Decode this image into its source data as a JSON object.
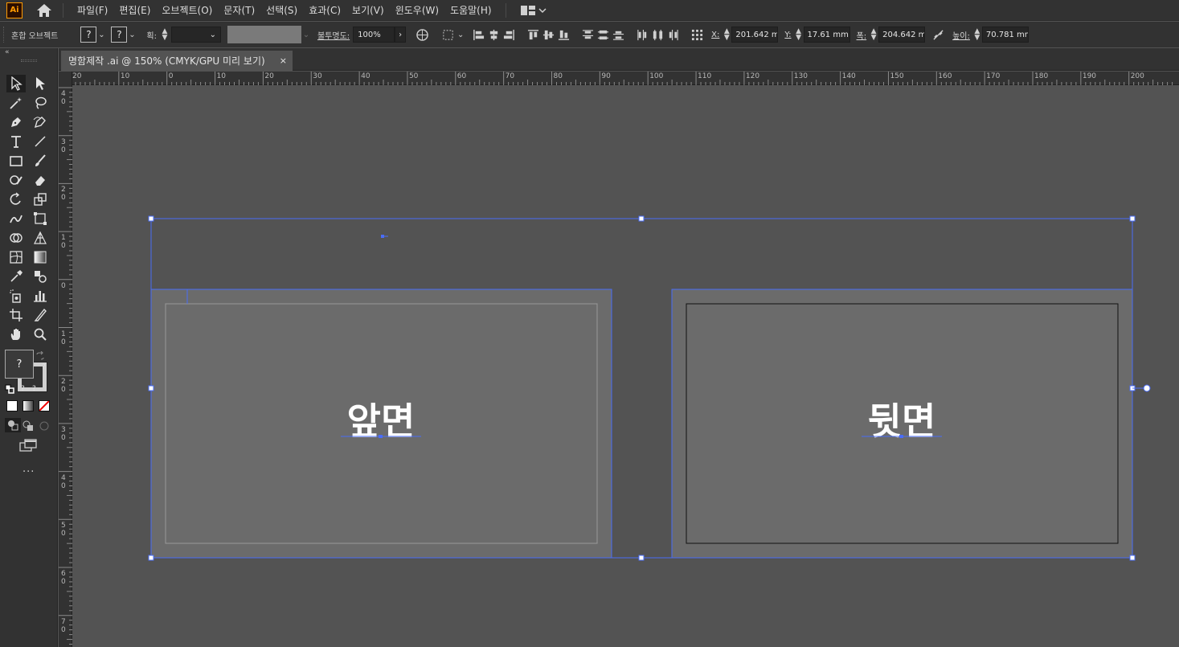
{
  "app": {
    "logo_text": "Ai",
    "window_title": "명함제작 .ai @ 150% (CMYK/GPU 미리 보기)"
  },
  "menu": {
    "items": [
      "파일(F)",
      "편집(E)",
      "오브젝트(O)",
      "문자(T)",
      "선택(S)",
      "효과(C)",
      "보기(V)",
      "윈도우(W)",
      "도움말(H)"
    ]
  },
  "control": {
    "object_type": "혼합 오브젝트",
    "fill_value": "?",
    "stroke_value": "?",
    "stroke_label": "획:",
    "opacity_label": "불투명도:",
    "opacity_value": "100%",
    "x_label": "X:",
    "x_value": "201.642 m",
    "y_label": "Y:",
    "y_value": "17.61 mm",
    "w_label": "폭:",
    "w_value": "204.642 m",
    "h_label": "높이:",
    "h_value": "70.781 mm"
  },
  "toolbox": {
    "fill_stroke_value": "?",
    "swatch_q": "?",
    "more_label": "..."
  },
  "tab": {
    "title": "명함제작 .ai @ 150% (CMYK/GPU 미리 보기)",
    "close": "×"
  },
  "ruler": {
    "h_labels": [
      "20",
      "10",
      "0",
      "10",
      "20",
      "30",
      "40",
      "50",
      "60",
      "70",
      "80",
      "90",
      "100",
      "110",
      "120",
      "130",
      "140",
      "150",
      "160",
      "170",
      "180",
      "190",
      "200"
    ],
    "v_labels": [
      "40",
      "30",
      "20",
      "10",
      "0",
      "10",
      "20",
      "30",
      "40",
      "50",
      "60",
      "70"
    ]
  },
  "artboards": {
    "front_label": "앞면",
    "back_label": "뒷면"
  },
  "colors": {
    "selection": "#4a6cf7",
    "ui_dark": "#323232",
    "canvas": "#535353",
    "artboard": "#6b6b6b"
  }
}
